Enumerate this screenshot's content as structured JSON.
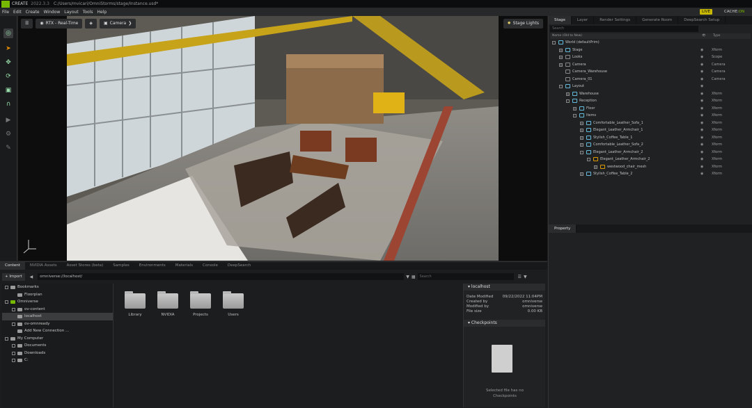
{
  "titlebar": {
    "app": "CREATE",
    "version": "2022.3.3",
    "path": "C:/Users/mvicari/OmniStorms/stage/Instance.usd*"
  },
  "menu": [
    "File",
    "Edit",
    "Create",
    "Window",
    "Layout",
    "Tools",
    "Help"
  ],
  "status": {
    "live": "LIVE",
    "cache_label": "CACHE:",
    "cache_state": "ON"
  },
  "viewport": {
    "renderer": "RTX - Real-Time",
    "camera": "Camera",
    "stage_lights": "Stage Lights"
  },
  "stage": {
    "tabs": [
      "Stage",
      "Layer",
      "Render Settings",
      "Generate Room",
      "DeepSearch Setup"
    ],
    "search_placeholder": "Search",
    "columns": {
      "name": "Name (Old to New)",
      "type": "Type"
    },
    "rows": [
      {
        "label": "World (defaultPrim)",
        "type": "",
        "depth": 0,
        "exp": "-",
        "icon": "#6bd"
      },
      {
        "label": "Stage",
        "type": "Xform",
        "depth": 1,
        "exp": "+",
        "icon": "#6bd"
      },
      {
        "label": "Looks",
        "type": "Scope",
        "depth": 1,
        "exp": "+",
        "icon": "#888"
      },
      {
        "label": "Camera",
        "type": "Camera",
        "depth": 1,
        "exp": "+",
        "icon": "#888"
      },
      {
        "label": "Camera_Warehouse",
        "type": "Camera",
        "depth": 1,
        "exp": "",
        "icon": "#888"
      },
      {
        "label": "Camera_01",
        "type": "Camera",
        "depth": 1,
        "exp": "",
        "icon": "#888"
      },
      {
        "label": "Layout",
        "type": "",
        "depth": 1,
        "exp": "-",
        "icon": "#6bd"
      },
      {
        "label": "Warehouse",
        "type": "Xform",
        "depth": 2,
        "exp": "+",
        "icon": "#6bd"
      },
      {
        "label": "Reception",
        "type": "Xform",
        "depth": 2,
        "exp": "-",
        "icon": "#6bd"
      },
      {
        "label": "Floor",
        "type": "Xform",
        "depth": 3,
        "exp": "+",
        "icon": "#6bd"
      },
      {
        "label": "Items",
        "type": "Xform",
        "depth": 3,
        "exp": "-",
        "icon": "#6bd"
      },
      {
        "label": "Comfortable_Leather_Sofa_1",
        "type": "Xform",
        "depth": 4,
        "exp": "+",
        "icon": "#6bd"
      },
      {
        "label": "Elegant_Leather_Armchair_1",
        "type": "Xform",
        "depth": 4,
        "exp": "+",
        "icon": "#6bd"
      },
      {
        "label": "Stylish_Coffee_Table_1",
        "type": "Xform",
        "depth": 4,
        "exp": "+",
        "icon": "#6bd"
      },
      {
        "label": "Comfortable_Leather_Sofa_2",
        "type": "Xform",
        "depth": 4,
        "exp": "+",
        "icon": "#6bd"
      },
      {
        "label": "Elegant_Leather_Armchair_2",
        "type": "Xform",
        "depth": 4,
        "exp": "-",
        "icon": "#6bd"
      },
      {
        "label": "Elegant_Leather_Armchair_2",
        "type": "Xform",
        "depth": 5,
        "exp": "-",
        "icon": "#d90"
      },
      {
        "label": "westwood_chair_mesh",
        "type": "Xform",
        "depth": 6,
        "exp": "+",
        "icon": "#d90"
      },
      {
        "label": "Stylish_Coffee_Table_2",
        "type": "Xform",
        "depth": 4,
        "exp": "+",
        "icon": "#6bd"
      }
    ]
  },
  "property": {
    "title": "Property"
  },
  "content": {
    "tabs": [
      "Content",
      "NVIDIA Assets",
      "Asset Stores (beta)",
      "Samples",
      "Environments",
      "Materials",
      "Console",
      "DeepSearch"
    ],
    "import_label": "Import",
    "path": "omniverse://localhost/",
    "search_placeholder": "Search",
    "tree": [
      {
        "label": "Bookmarks",
        "depth": 0,
        "exp": true,
        "icon": "#9a9a9a"
      },
      {
        "label": "Floorplan",
        "depth": 1,
        "exp": false,
        "icon": "#9a9a9a"
      },
      {
        "label": "Omniverse",
        "depth": 0,
        "exp": true,
        "icon": "#76b900"
      },
      {
        "label": "ov-content",
        "depth": 1,
        "exp": true,
        "icon": "#9a9a9a"
      },
      {
        "label": "localhost",
        "depth": 1,
        "exp": false,
        "icon": "#9a9a9a",
        "sel": true
      },
      {
        "label": "ov-omnready",
        "depth": 1,
        "exp": true,
        "icon": "#9a9a9a"
      },
      {
        "label": "Add New Connection ...",
        "depth": 1,
        "exp": false,
        "icon": "#9a9a9a"
      },
      {
        "label": "My Computer",
        "depth": 0,
        "exp": true,
        "icon": "#9a9a9a"
      },
      {
        "label": "Documents",
        "depth": 1,
        "exp": true,
        "icon": "#9a9a9a"
      },
      {
        "label": "Downloads",
        "depth": 1,
        "exp": true,
        "icon": "#9a9a9a"
      },
      {
        "label": "C:",
        "depth": 1,
        "exp": true,
        "icon": "#9a9a9a"
      }
    ],
    "folders": [
      "Library",
      "NVIDIA",
      "Projects",
      "Users"
    ],
    "info": {
      "title": "localhost",
      "rows": [
        {
          "k": "Date Modified",
          "v": "09/22/2022 11:04PM"
        },
        {
          "k": "Created by",
          "v": "omniverse"
        },
        {
          "k": "Modified by",
          "v": "omniverse"
        },
        {
          "k": "File size",
          "v": "0.00 KB"
        }
      ],
      "checkpoints_title": "Checkpoints",
      "checkpoints_msg1": "Selected file has no",
      "checkpoints_msg2": "Checkpoints"
    }
  }
}
